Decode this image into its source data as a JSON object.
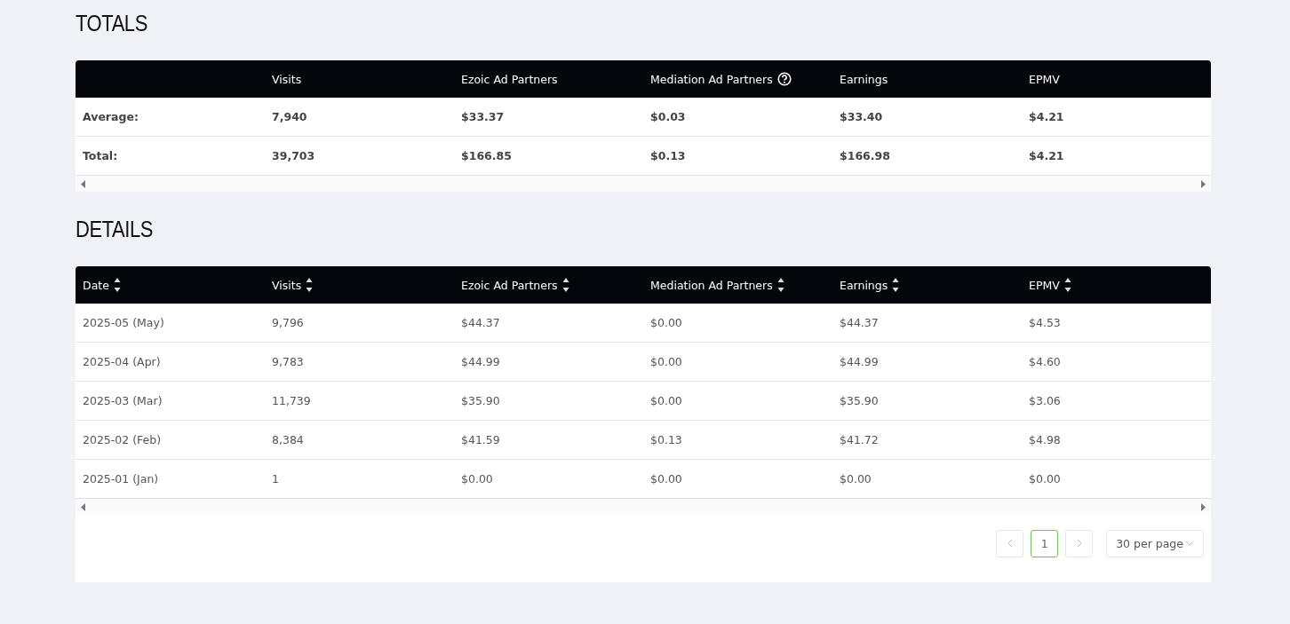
{
  "totals": {
    "title": "TOTALS",
    "columns": [
      {
        "help": false
      },
      {
        "label": "Visits",
        "help": false
      },
      {
        "label": "Ezoic Ad Partners",
        "help": false
      },
      {
        "label": "Mediation Ad Partners",
        "help": true
      },
      {
        "label": "Earnings",
        "help": false
      },
      {
        "label": "EPMV",
        "help": false
      }
    ],
    "rows": [
      [
        "Average:",
        "7,940",
        "$33.37",
        "$0.03",
        "$33.40",
        "$4.21"
      ],
      [
        "Total:",
        "39,703",
        "$166.85",
        "$0.13",
        "$166.98",
        "$4.21"
      ]
    ]
  },
  "details": {
    "title": "DETAILS",
    "columns": [
      {
        "label": "Date",
        "sortable": true
      },
      {
        "label": "Visits",
        "sortable": true
      },
      {
        "label": "Ezoic Ad Partners",
        "sortable": true
      },
      {
        "label": "Mediation Ad Partners",
        "sortable": true
      },
      {
        "label": "Earnings",
        "sortable": true
      },
      {
        "label": "EPMV",
        "sortable": true
      }
    ],
    "rows": [
      [
        "2025-05 (May)",
        "9,796",
        "$44.37",
        "$0.00",
        "$44.37",
        "$4.53"
      ],
      [
        "2025-04 (Apr)",
        "9,783",
        "$44.99",
        "$0.00",
        "$44.99",
        "$4.60"
      ],
      [
        "2025-03 (Mar)",
        "11,739",
        "$35.90",
        "$0.00",
        "$35.90",
        "$3.06"
      ],
      [
        "2025-02 (Feb)",
        "8,384",
        "$41.59",
        "$0.13",
        "$41.72",
        "$4.98"
      ],
      [
        "2025-01 (Jan)",
        "1",
        "$0.00",
        "$0.00",
        "$0.00",
        "$0.00"
      ]
    ],
    "pagination": {
      "pages": [
        {
          "label": "1",
          "selected": true
        }
      ],
      "per_page": "30 per page"
    }
  }
}
